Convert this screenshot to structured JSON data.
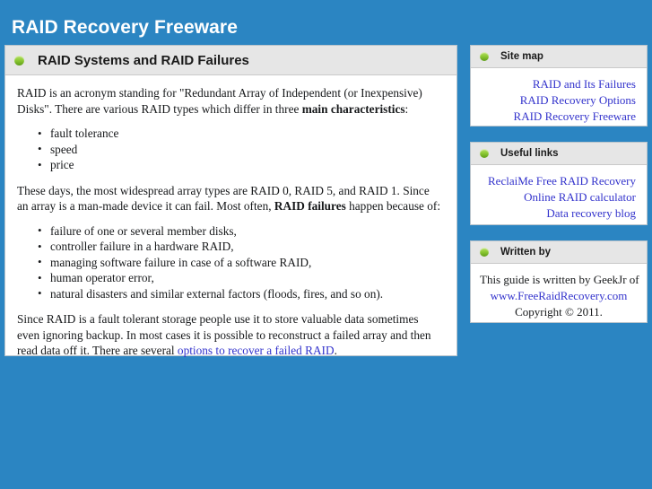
{
  "site": {
    "title": "RAID Recovery Freeware",
    "accent_blue": "#2b85c2",
    "link_color": "#3333cc",
    "panel_head_bg": "#e6e6e6",
    "bullet_color": "#7ab82a"
  },
  "main": {
    "heading": "RAID Systems and RAID Failures",
    "bullet_icon": "green-dot-icon",
    "paragraph1": {
      "part1": "RAID is an acronym standing for \"Redundant Array of Independent (or Inexpensive) Disks\". There are various RAID types which differ in three ",
      "bold": "main characteristics",
      "part2": ":"
    },
    "list1": [
      "fault tolerance",
      "speed",
      "price"
    ],
    "paragraph2": {
      "part1": "These days, the most widespread array types are RAID 0, RAID 5, and RAID 1. Since an array is a man-made device it can fail. Most often, ",
      "bold": "RAID failures",
      "part2": " happen because of:"
    },
    "list2": [
      "failure of one or several member disks,",
      "controller failure in a hardware RAID,",
      "managing software failure in case of a software RAID,",
      "human operator error,",
      "natural disasters and similar external factors (floods, fires, and so on)."
    ],
    "paragraph3": {
      "part1": "Since RAID is a fault tolerant storage people use it to store valuable data sometimes even ignoring backup. In most cases it is possible to reconstruct a failed array and then read data off it. There are several ",
      "link": "options to recover a failed RAID",
      "part2": "."
    }
  },
  "sidebar": {
    "sitemap": {
      "heading": "Site map",
      "bullet_icon": "green-dot-icon",
      "links": [
        "RAID and Its Failures",
        "RAID Recovery Options",
        "RAID Recovery Freeware"
      ]
    },
    "useful_links": {
      "heading": "Useful links",
      "bullet_icon": "green-dot-icon",
      "links": [
        "ReclaiMe Free RAID Recovery",
        "Online RAID calculator",
        "Data recovery blog"
      ]
    },
    "written_by": {
      "heading": "Written by",
      "bullet_icon": "green-dot-icon",
      "line1": "This guide is written by GeekJr of",
      "link": "www.FreeRaidRecovery.com",
      "line3": "Copyright © 2011."
    }
  }
}
